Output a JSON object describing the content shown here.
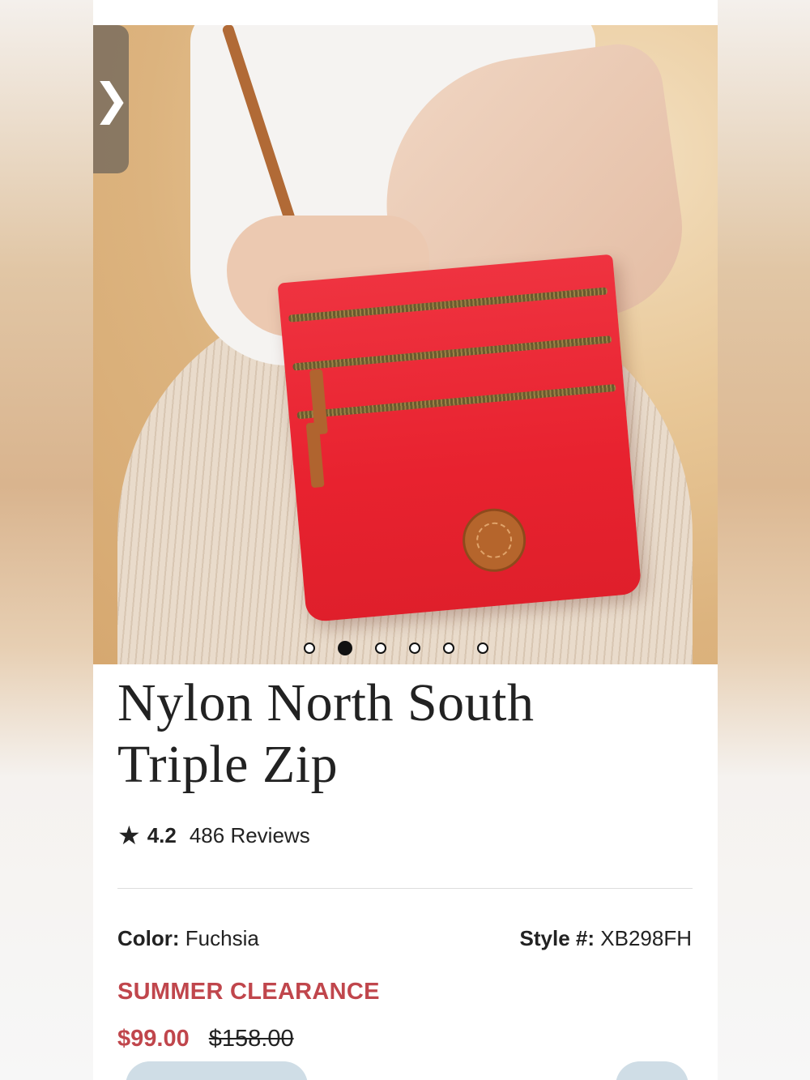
{
  "carousel": {
    "prev_glyph": "❯",
    "dot_count": 6,
    "active_index": 1
  },
  "product": {
    "title_line1": "Nylon North South",
    "title_line2": "Triple Zip",
    "rating": "4.2",
    "reviews": "486 Reviews",
    "color_label": "Color:",
    "color_value": "Fuchsia",
    "style_label": "Style #:",
    "style_value": "XB298FH",
    "promo": "SUMMER CLEARANCE",
    "price_now": "$99.00",
    "price_old": "$158.00"
  },
  "colors": {
    "accent": "#c0464c",
    "text": "#222222"
  },
  "icons": {
    "star": "star-icon",
    "prev": "chevron-right-icon"
  }
}
